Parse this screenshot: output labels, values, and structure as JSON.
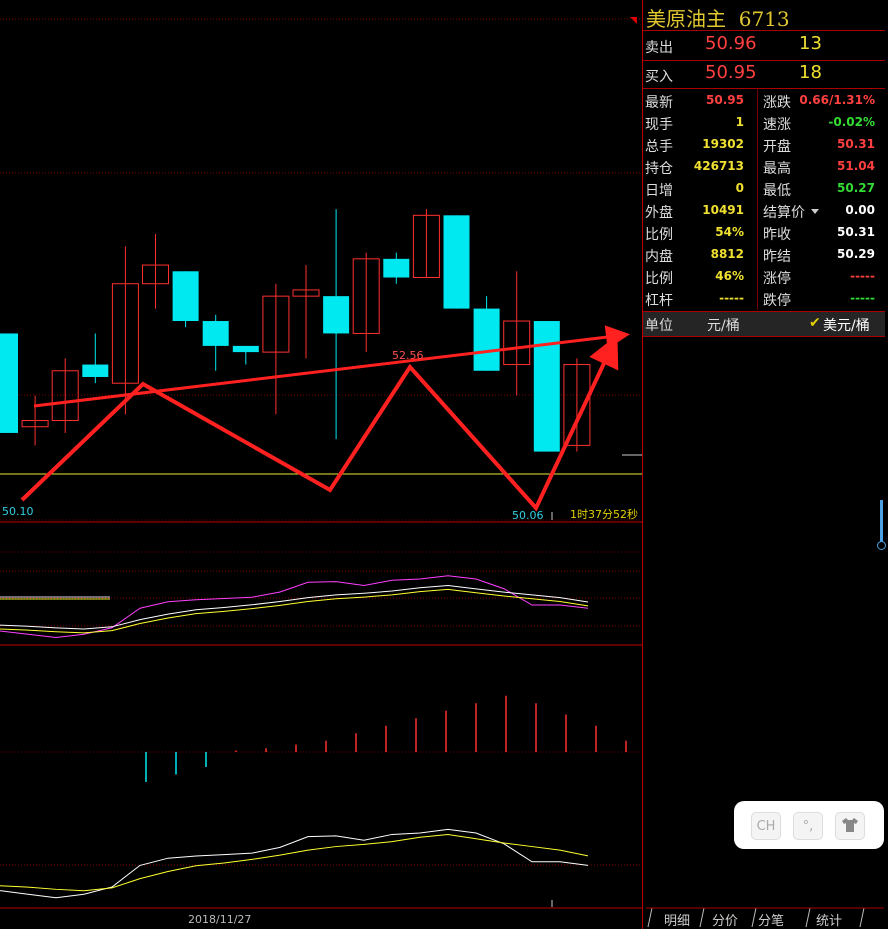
{
  "header": {
    "instrument_name": "美原油主",
    "code": "6713"
  },
  "quote": [
    {
      "label": "卖出",
      "price": "50.96",
      "volume": "13"
    },
    {
      "label": "买入",
      "price": "50.95",
      "volume": "18"
    }
  ],
  "stats": [
    {
      "l1": "最新",
      "v1": "50.95",
      "c1": "#ff4040",
      "l2": "涨跌",
      "v2": "0.66/1.31%",
      "c2": "#ff4040"
    },
    {
      "l1": "现手",
      "v1": "1",
      "c1": "#f0e030",
      "l2": "速涨",
      "v2": "-0.02%",
      "c2": "#33dd33"
    },
    {
      "l1": "总手",
      "v1": "19302",
      "c1": "#f0e030",
      "l2": "开盘",
      "v2": "50.31",
      "c2": "#ff4040"
    },
    {
      "l1": "持仓",
      "v1": "426713",
      "c1": "#f0e030",
      "l2": "最高",
      "v2": "51.04",
      "c2": "#ff4040"
    },
    {
      "l1": "日增",
      "v1": "0",
      "c1": "#f0e030",
      "l2": "最低",
      "v2": "50.27",
      "c2": "#33dd33"
    },
    {
      "l1": "外盘",
      "v1": "10491",
      "c1": "#f0e030",
      "l2": "结算价",
      "v2": "0.00",
      "c2": "#ffffff"
    },
    {
      "l1": "比例",
      "v1": "54%",
      "c1": "#f0e030",
      "l2": "昨收",
      "v2": "50.31",
      "c2": "#ffffff"
    },
    {
      "l1": "内盘",
      "v1": "8812",
      "c1": "#f0e030",
      "l2": "昨结",
      "v2": "50.29",
      "c2": "#ffffff"
    },
    {
      "l1": "比例",
      "v1": "46%",
      "c1": "#f0e030",
      "l2": "涨停",
      "v2": "-----",
      "c2": "#ff4040"
    },
    {
      "l1": "杠杆",
      "v1": "-----",
      "c1": "#f0e030",
      "l2": "跌停",
      "v2": "-----",
      "c2": "#33dd33"
    }
  ],
  "unit": {
    "label": "单位",
    "value1": "元/桶",
    "value2": "美元/桶",
    "check": "✔"
  },
  "tabs": [
    "明细",
    "分价",
    "分笔",
    "统计"
  ],
  "tools": [
    "CH",
    "°,",
    "shirt-icon"
  ],
  "chart_labels": {
    "high": "52.56",
    "low_left": "50.10",
    "low_right": "50.06",
    "countdown": "1时37分52秒",
    "date": "2018/11/27"
  },
  "chart_data": {
    "type": "candlestick",
    "y_range": [
      49.7,
      53.6
    ],
    "candles": [
      {
        "o": 51.2,
        "c": 50.4,
        "h": 51.2,
        "l": 50.4,
        "dir": "down"
      },
      {
        "o": 50.45,
        "c": 50.5,
        "h": 50.7,
        "l": 50.3,
        "dir": "up"
      },
      {
        "o": 50.5,
        "c": 50.9,
        "h": 51.0,
        "l": 50.4,
        "dir": "up"
      },
      {
        "o": 50.85,
        "c": 50.95,
        "h": 51.2,
        "l": 50.8,
        "dir": "down"
      },
      {
        "o": 50.8,
        "c": 51.6,
        "h": 51.9,
        "l": 50.55,
        "dir": "up"
      },
      {
        "o": 51.6,
        "c": 51.75,
        "h": 52.0,
        "l": 51.4,
        "dir": "up"
      },
      {
        "o": 51.7,
        "c": 51.3,
        "h": 51.7,
        "l": 51.25,
        "dir": "down"
      },
      {
        "o": 51.3,
        "c": 51.1,
        "h": 51.35,
        "l": 50.9,
        "dir": "down"
      },
      {
        "o": 51.1,
        "c": 51.05,
        "h": 51.1,
        "l": 50.95,
        "dir": "down"
      },
      {
        "o": 51.05,
        "c": 51.5,
        "h": 51.6,
        "l": 50.55,
        "dir": "up"
      },
      {
        "o": 51.5,
        "c": 51.55,
        "h": 51.75,
        "l": 51.0,
        "dir": "up"
      },
      {
        "o": 51.5,
        "c": 51.2,
        "h": 52.2,
        "l": 50.35,
        "dir": "down"
      },
      {
        "o": 51.2,
        "c": 51.8,
        "h": 51.85,
        "l": 51.05,
        "dir": "up"
      },
      {
        "o": 51.65,
        "c": 51.8,
        "h": 51.85,
        "l": 51.6,
        "dir": "down"
      },
      {
        "o": 51.65,
        "c": 52.15,
        "h": 52.2,
        "l": 51.65,
        "dir": "up"
      },
      {
        "o": 52.15,
        "c": 51.4,
        "h": 52.15,
        "l": 51.4,
        "dir": "down"
      },
      {
        "o": 51.4,
        "c": 50.9,
        "h": 51.5,
        "l": 50.9,
        "dir": "down"
      },
      {
        "o": 50.95,
        "c": 51.3,
        "h": 51.7,
        "l": 50.7,
        "dir": "up"
      },
      {
        "o": 51.3,
        "c": 50.25,
        "h": 51.3,
        "l": 50.25,
        "dir": "down"
      },
      {
        "o": 50.3,
        "c": 50.95,
        "h": 51.0,
        "l": 50.25,
        "dir": "up"
      }
    ],
    "macd_bars": [
      0,
      0,
      0,
      0,
      -0.4,
      -0.3,
      -0.2,
      0.02,
      0.05,
      0.1,
      0.15,
      0.25,
      0.35,
      0.45,
      0.55,
      0.65,
      0.75,
      0.65,
      0.5,
      0.35,
      0.15,
      0.15
    ],
    "ma_fast": [
      0.2,
      0.15,
      0.1,
      0.15,
      0.25,
      0.55,
      0.65,
      0.68,
      0.7,
      0.72,
      0.8,
      0.95,
      0.96,
      0.9,
      0.98,
      1.0,
      1.05,
      1.0,
      0.85,
      0.6,
      0.6,
      0.55
    ],
    "ma_slow": [
      0.2,
      0.18,
      0.15,
      0.13,
      0.17,
      0.3,
      0.4,
      0.48,
      0.52,
      0.57,
      0.63,
      0.7,
      0.75,
      0.78,
      0.82,
      0.88,
      0.92,
      0.86,
      0.8,
      0.75,
      0.7,
      0.62
    ]
  },
  "colors": {
    "up": "#ff3030",
    "down": "#00e8f0",
    "grid": "#7a0000",
    "ma5": "#ffffff",
    "ma10": "#ffff30",
    "ma20": "#ff40ff",
    "trend": "#ff2020"
  }
}
